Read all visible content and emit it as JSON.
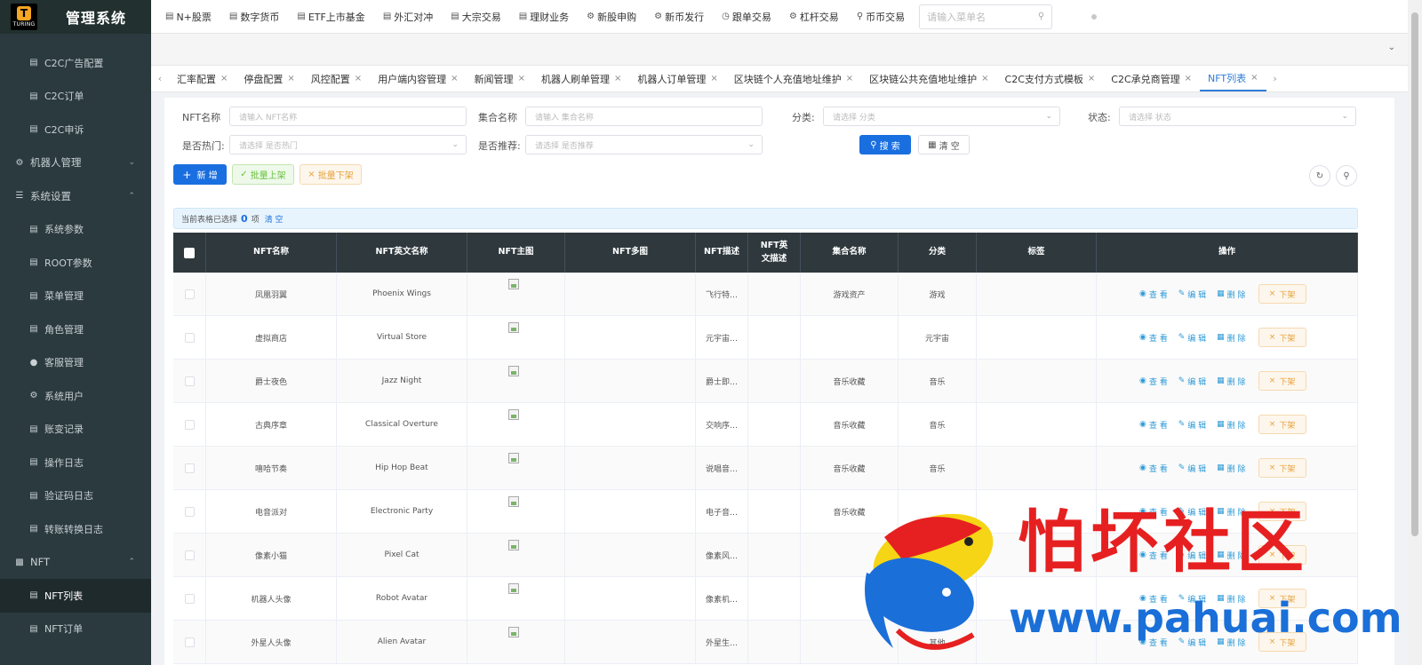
{
  "app": {
    "logo_text": "TURING",
    "logo_letter": "T",
    "title": "管理系统"
  },
  "sidebar": {
    "items": [
      {
        "label": "C2C广告配置",
        "icon": "doc-icon",
        "type": "item",
        "active": false
      },
      {
        "label": "C2C订单",
        "icon": "doc-icon",
        "type": "item",
        "active": false
      },
      {
        "label": "C2C申诉",
        "icon": "doc-icon",
        "type": "item",
        "active": false
      },
      {
        "label": "机器人管理",
        "icon": "gear-icon",
        "type": "group",
        "caret": "down"
      },
      {
        "label": "系统设置",
        "icon": "list-icon",
        "type": "group",
        "caret": "up"
      },
      {
        "label": "系统参数",
        "icon": "doc-icon",
        "type": "item",
        "active": false
      },
      {
        "label": "ROOT参数",
        "icon": "doc-icon",
        "type": "item",
        "active": false
      },
      {
        "label": "菜单管理",
        "icon": "doc-icon",
        "type": "item",
        "active": false
      },
      {
        "label": "角色管理",
        "icon": "doc-icon",
        "type": "item",
        "active": false
      },
      {
        "label": "客服管理",
        "icon": "user-icon",
        "type": "item",
        "active": false
      },
      {
        "label": "系统用户",
        "icon": "gear-icon",
        "type": "item",
        "active": false
      },
      {
        "label": "账变记录",
        "icon": "doc-icon",
        "type": "item",
        "active": false
      },
      {
        "label": "操作日志",
        "icon": "doc-icon",
        "type": "item",
        "active": false
      },
      {
        "label": "验证码日志",
        "icon": "doc-icon",
        "type": "item",
        "active": false
      },
      {
        "label": "转账转换日志",
        "icon": "doc-icon",
        "type": "item",
        "active": false
      },
      {
        "label": "NFT",
        "icon": "chart-icon",
        "type": "group",
        "caret": "up"
      },
      {
        "label": "NFT列表",
        "icon": "doc-icon",
        "type": "item",
        "active": true
      },
      {
        "label": "NFT订单",
        "icon": "doc-icon",
        "type": "item",
        "active": false
      }
    ]
  },
  "topbar": {
    "items": [
      "N+股票",
      "数字货币",
      "ETF上市基金",
      "外汇对冲",
      "大宗交易",
      "理财业务",
      "新股申购",
      "新币发行",
      "跟单交易",
      "杠杆交易",
      "币币交易"
    ],
    "search_placeholder": "请输入菜单名"
  },
  "tabs": [
    {
      "label": "汇率配置",
      "active": false
    },
    {
      "label": "停盘配置",
      "active": false
    },
    {
      "label": "风控配置",
      "active": false
    },
    {
      "label": "用户端内容管理",
      "active": false
    },
    {
      "label": "新闻管理",
      "active": false
    },
    {
      "label": "机器人刷单管理",
      "active": false
    },
    {
      "label": "机器人订单管理",
      "active": false
    },
    {
      "label": "区块链个人充值地址维护",
      "active": false
    },
    {
      "label": "区块链公共充值地址维护",
      "active": false
    },
    {
      "label": "C2C支付方式模板",
      "active": false
    },
    {
      "label": "C2C承兑商管理",
      "active": false
    },
    {
      "label": "NFT列表",
      "active": true
    }
  ],
  "filters": {
    "nft_name": {
      "label": "NFT名称",
      "placeholder": "请输入 NFT名称"
    },
    "collection": {
      "label": "集合名称",
      "placeholder": "请输入 集合名称"
    },
    "category": {
      "label": "分类:",
      "placeholder": "请选择 分类"
    },
    "status": {
      "label": "状态:",
      "placeholder": "请选择 状态"
    },
    "hot": {
      "label": "是否热门:",
      "placeholder": "请选择 是否热门"
    },
    "recommend": {
      "label": "是否推荐:",
      "placeholder": "请选择 是否推荐"
    }
  },
  "buttons": {
    "search": "搜 索",
    "clear": "清 空",
    "add": "新 增",
    "batch_up": "批量上架",
    "batch_down": "批量下架"
  },
  "selection": {
    "prefix": "当前表格已选择",
    "count": "0",
    "suffix": "项",
    "clear": "清 空"
  },
  "table": {
    "columns": [
      "NFT名称",
      "NFT英文名称",
      "NFT主图",
      "NFT多图",
      "NFT描述",
      "NFT英文描述",
      "集合名称",
      "分类",
      "标签",
      "操作"
    ],
    "rows": [
      {
        "name": "凤凰羽翼",
        "en_name": "Phoenix Wings",
        "desc": "飞行特…",
        "collection": "游戏资产",
        "category": "游戏"
      },
      {
        "name": "虚拟商店",
        "en_name": "Virtual Store",
        "desc": "元宇宙…",
        "collection": "",
        "category": "元宇宙"
      },
      {
        "name": "爵士夜色",
        "en_name": "Jazz Night",
        "desc": "爵士即…",
        "collection": "音乐收藏",
        "category": "音乐"
      },
      {
        "name": "古典序章",
        "en_name": "Classical Overture",
        "desc": "交响序…",
        "collection": "音乐收藏",
        "category": "音乐"
      },
      {
        "name": "嘻哈节奏",
        "en_name": "Hip Hop Beat",
        "desc": "说唱音…",
        "collection": "音乐收藏",
        "category": "音乐"
      },
      {
        "name": "电音派对",
        "en_name": "Electronic Party",
        "desc": "电子音…",
        "collection": "音乐收藏",
        "category": ""
      },
      {
        "name": "像素小猫",
        "en_name": "Pixel Cat",
        "desc": "像素风…",
        "collection": "",
        "category": "其他"
      },
      {
        "name": "机器人头像",
        "en_name": "Robot Avatar",
        "desc": "像素机…",
        "collection": "",
        "category": ""
      },
      {
        "name": "外星人头像",
        "en_name": "Alien Avatar",
        "desc": "外星生…",
        "collection": "",
        "category": "其他"
      }
    ],
    "ops": {
      "view": "查 看",
      "edit": "编 辑",
      "delete": "删 除",
      "down": "下架"
    }
  },
  "watermark": {
    "text": "怕坏社区",
    "url": "www.pahuai.com"
  },
  "colors": {
    "primary": "#1a6fe0",
    "sidebar": "#2b3a3f",
    "table_header": "#2e383d",
    "watermark_red": "#e62020",
    "watermark_blue": "#1a6fd8"
  }
}
